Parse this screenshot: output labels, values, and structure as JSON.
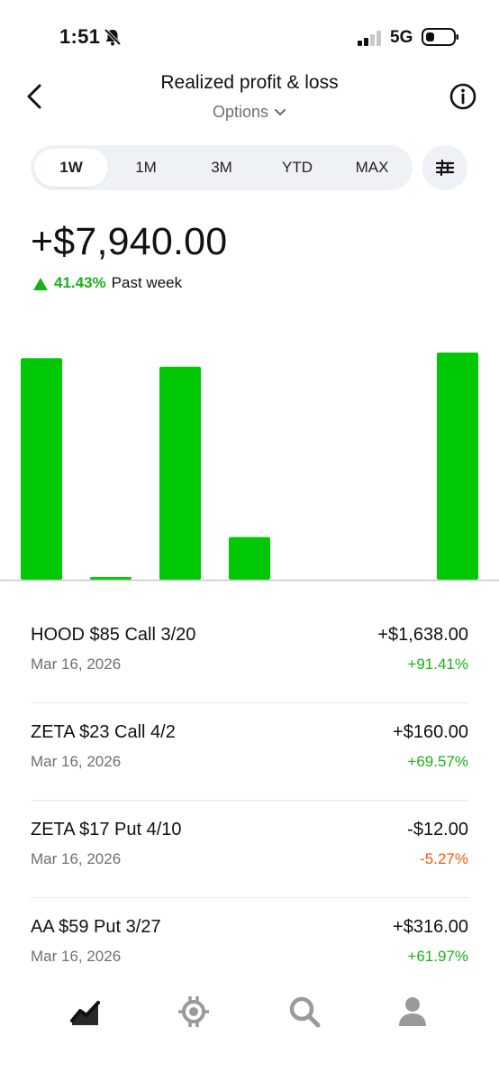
{
  "status_bar": {
    "time": "1:51",
    "network": "5G"
  },
  "header": {
    "title": "Realized profit & loss",
    "subtitle": "Options"
  },
  "range_tabs": [
    {
      "label": "1W",
      "active": true
    },
    {
      "label": "1M",
      "active": false
    },
    {
      "label": "3M",
      "active": false
    },
    {
      "label": "YTD",
      "active": false
    },
    {
      "label": "MAX",
      "active": false
    }
  ],
  "summary": {
    "total": "+$7,940.00",
    "change_pct": "41.43%",
    "period": "Past week"
  },
  "colors": {
    "positive": "#1ab21a",
    "negative": "#ef5a12",
    "bar": "#00c805"
  },
  "chart_data": {
    "type": "bar",
    "values": [
      1638,
      20,
      1575,
      316,
      0,
      0,
      1680
    ]
  },
  "trades": [
    {
      "title": "HOOD $85 Call 3/20",
      "date": "Mar 16, 2026",
      "amount": "+$1,638.00",
      "pct": "+91.41%",
      "direction": "pos"
    },
    {
      "title": "ZETA $23 Call 4/2",
      "date": "Mar 16, 2026",
      "amount": "+$160.00",
      "pct": "+69.57%",
      "direction": "pos"
    },
    {
      "title": "ZETA $17 Put 4/10",
      "date": "Mar 16, 2026",
      "amount": "-$12.00",
      "pct": "-5.27%",
      "direction": "neg"
    },
    {
      "title": "AA $59 Put 3/27",
      "date": "Mar 16, 2026",
      "amount": "+$316.00",
      "pct": "+61.97%",
      "direction": "pos"
    }
  ],
  "tab_bar": {
    "items": [
      {
        "icon": "investing-chart-icon",
        "active": true
      },
      {
        "icon": "crypto-icon",
        "active": false
      },
      {
        "icon": "search-icon",
        "active": false
      },
      {
        "icon": "account-icon",
        "active": false
      }
    ]
  }
}
